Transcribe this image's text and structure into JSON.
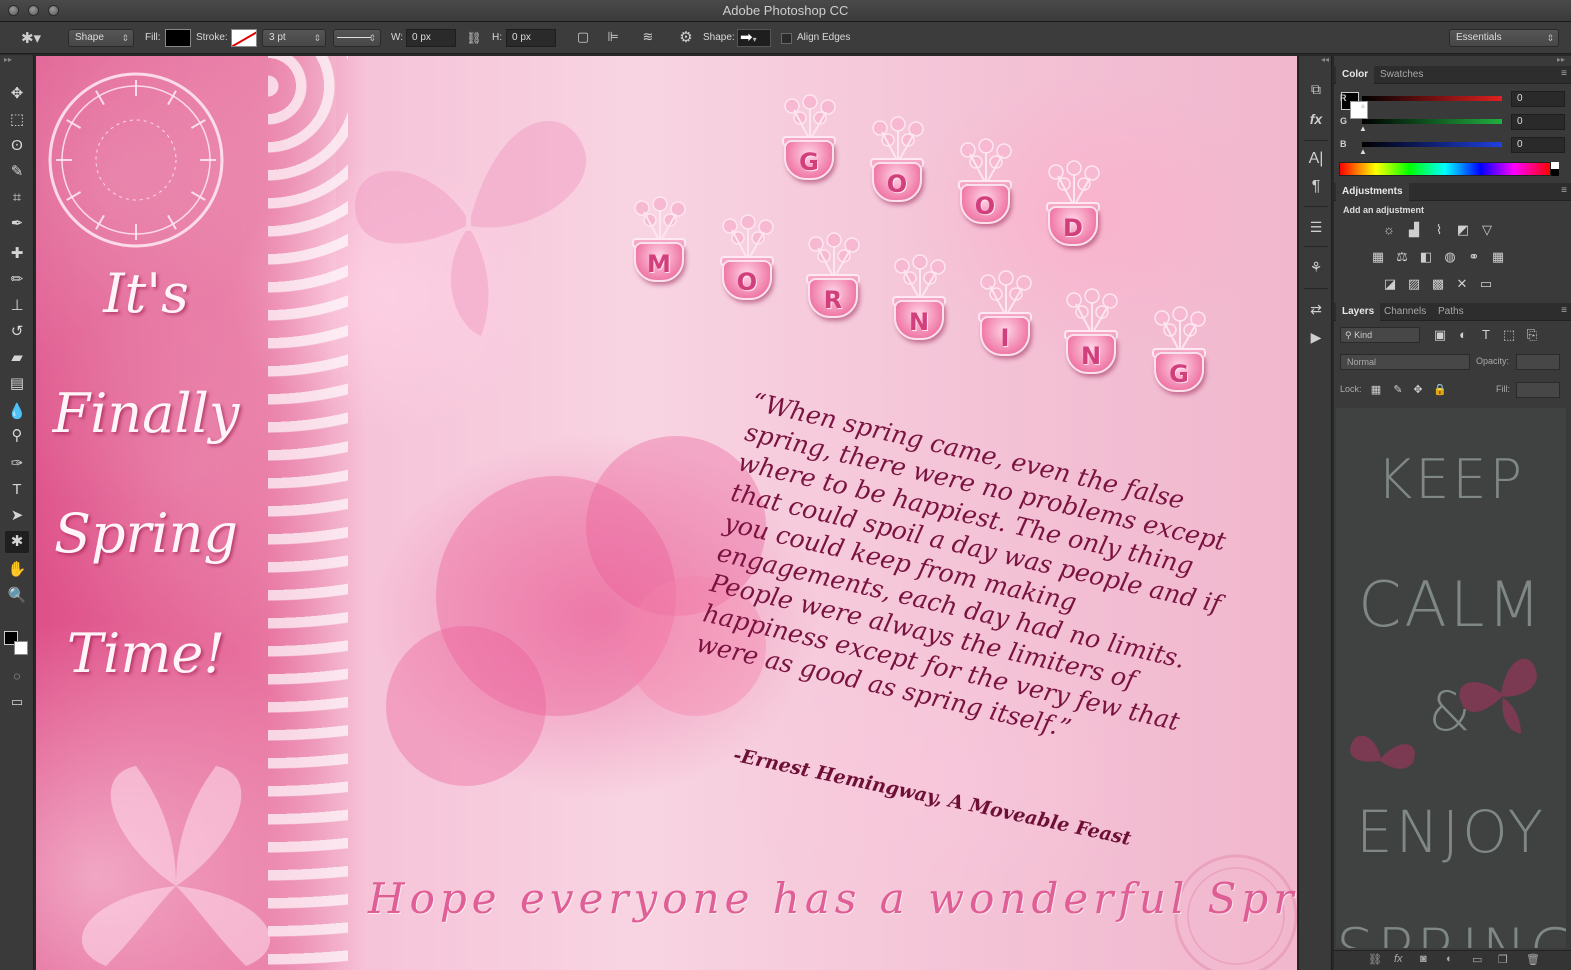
{
  "app": {
    "title": "Adobe Photoshop CC"
  },
  "options_bar": {
    "mode": "Shape",
    "fill_label": "Fill:",
    "stroke_label": "Stroke:",
    "stroke_width": "3 pt",
    "w_label": "W:",
    "w_value": "0 px",
    "h_label": "H:",
    "h_value": "0 px",
    "shape_label": "Shape:",
    "align_edges": "Align Edges",
    "workspace": "Essentials"
  },
  "tools": [
    {
      "icon": "move-icon",
      "glyph": "✥"
    },
    {
      "icon": "marquee-icon",
      "glyph": "⬚"
    },
    {
      "icon": "lasso-icon",
      "glyph": "ʘ"
    },
    {
      "icon": "quick-select-icon",
      "glyph": "✎"
    },
    {
      "icon": "crop-icon",
      "glyph": "⌗"
    },
    {
      "icon": "eyedropper-icon",
      "glyph": "✒"
    },
    {
      "icon": "healing-brush-icon",
      "glyph": "✚"
    },
    {
      "icon": "brush-icon",
      "glyph": "✏"
    },
    {
      "icon": "clone-stamp-icon",
      "glyph": "⊥"
    },
    {
      "icon": "history-brush-icon",
      "glyph": "↺"
    },
    {
      "icon": "eraser-icon",
      "glyph": "▰"
    },
    {
      "icon": "gradient-icon",
      "glyph": "▤"
    },
    {
      "icon": "blur-icon",
      "glyph": "💧"
    },
    {
      "icon": "dodge-icon",
      "glyph": "⚲"
    },
    {
      "icon": "pen-icon",
      "glyph": "✑"
    },
    {
      "icon": "type-icon",
      "glyph": "T"
    },
    {
      "icon": "path-select-icon",
      "glyph": "➤"
    },
    {
      "icon": "custom-shape-icon",
      "glyph": "✱"
    },
    {
      "icon": "hand-icon",
      "glyph": "✋"
    },
    {
      "icon": "zoom-icon",
      "glyph": "🔍"
    }
  ],
  "canvas": {
    "left_text": [
      "It's",
      "Finally",
      "Spring",
      "Time!"
    ],
    "good": [
      "G",
      "O",
      "O",
      "D"
    ],
    "morning": [
      "M",
      "O",
      "R",
      "N",
      "I",
      "N",
      "G"
    ],
    "quote": "“When spring came, even the false\nspring, there were no problems except\nwhere to be happiest. The only thing\nthat could spoil a day was people and if\nyou could keep from making\nengagements, each day had no limits.\nPeople were always the limiters of\nhappiness except for the very few that\nwere as good as spring itself.”",
    "attribution": "-Ernest Hemingway, A Moveable Feast",
    "footer": "Hope everyone has a wonderful Spring!"
  },
  "color_panel": {
    "tabs": [
      "Color",
      "Swatches"
    ],
    "channels": [
      {
        "label": "R",
        "value": "0",
        "color": "#e02020"
      },
      {
        "label": "G",
        "value": "0",
        "color": "#20b040"
      },
      {
        "label": "B",
        "value": "0",
        "color": "#2040e0"
      }
    ]
  },
  "adjustments_panel": {
    "tab": "Adjustments",
    "heading": "Add an adjustment"
  },
  "layers_panel": {
    "tabs": [
      "Layers",
      "Channels",
      "Paths"
    ],
    "filter": "Kind",
    "blend_mode": "Normal",
    "opacity_label": "Opacity:",
    "lock_label": "Lock:",
    "fill_label": "Fill:",
    "preview_words": [
      "KEEP",
      "CALM",
      "&",
      "ENJOY",
      "SPRING"
    ]
  },
  "colors": {
    "accent_pink": "#e86a9d",
    "ui_dark": "#3a3a3a",
    "panel_preview_bg": "#3f4240"
  }
}
